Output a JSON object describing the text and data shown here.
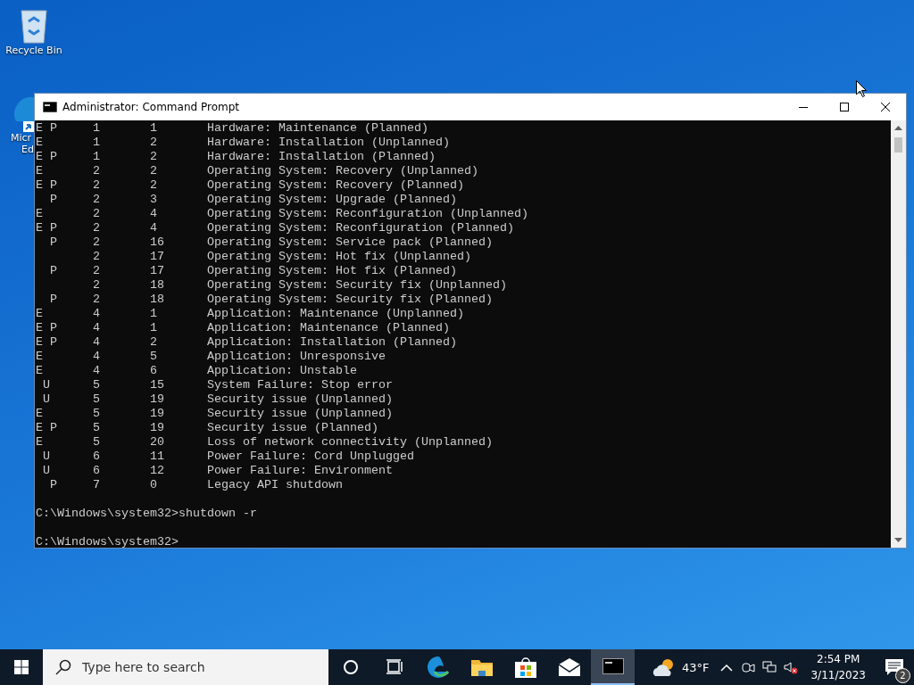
{
  "desktop": {
    "icons": [
      {
        "kind": "recycle-bin",
        "label_lines": [
          "Recycle Bin"
        ]
      },
      {
        "kind": "edge",
        "label_lines": [
          "Micr",
          "Ed"
        ]
      }
    ]
  },
  "window": {
    "title": "Administrator: Command Prompt",
    "output_lines": [
      "E P     1       1       Hardware: Maintenance (Planned)",
      "E       1       2       Hardware: Installation (Unplanned)",
      "E P     1       2       Hardware: Installation (Planned)",
      "E       2       2       Operating System: Recovery (Unplanned)",
      "E P     2       2       Operating System: Recovery (Planned)",
      "  P     2       3       Operating System: Upgrade (Planned)",
      "E       2       4       Operating System: Reconfiguration (Unplanned)",
      "E P     2       4       Operating System: Reconfiguration (Planned)",
      "  P     2       16      Operating System: Service pack (Planned)",
      "        2       17      Operating System: Hot fix (Unplanned)",
      "  P     2       17      Operating System: Hot fix (Planned)",
      "        2       18      Operating System: Security fix (Unplanned)",
      "  P     2       18      Operating System: Security fix (Planned)",
      "E       4       1       Application: Maintenance (Unplanned)",
      "E P     4       1       Application: Maintenance (Planned)",
      "E P     4       2       Application: Installation (Planned)",
      "E       4       5       Application: Unresponsive",
      "E       4       6       Application: Unstable",
      " U      5       15      System Failure: Stop error",
      " U      5       19      Security issue (Unplanned)",
      "E       5       19      Security issue (Unplanned)",
      "E P     5       19      Security issue (Planned)",
      "E       5       20      Loss of network connectivity (Unplanned)",
      " U      6       11      Power Failure: Cord Unplugged",
      " U      6       12      Power Failure: Environment",
      "  P     7       0       Legacy API shutdown"
    ],
    "prompt_lines": [
      "C:\\Windows\\system32>shutdown -r",
      "C:\\Windows\\system32>"
    ]
  },
  "taskbar": {
    "search": {
      "placeholder": "Type here to search"
    },
    "apps": [
      {
        "kind": "cortana",
        "active": false
      },
      {
        "kind": "task-view",
        "active": false
      },
      {
        "kind": "edge",
        "active": false
      },
      {
        "kind": "folder",
        "active": false
      },
      {
        "kind": "store",
        "active": false
      },
      {
        "kind": "mail",
        "active": false
      },
      {
        "kind": "terminal",
        "active": true
      }
    ],
    "weather": {
      "temperature": "43°F"
    },
    "tray_icons": [
      {
        "kind": "chevron"
      },
      {
        "kind": "camera"
      },
      {
        "kind": "network"
      },
      {
        "kind": "volume-muted"
      }
    ],
    "clock": {
      "time": "2:54 PM",
      "date": "3/11/2023"
    },
    "notifications": {
      "count": "2"
    }
  }
}
